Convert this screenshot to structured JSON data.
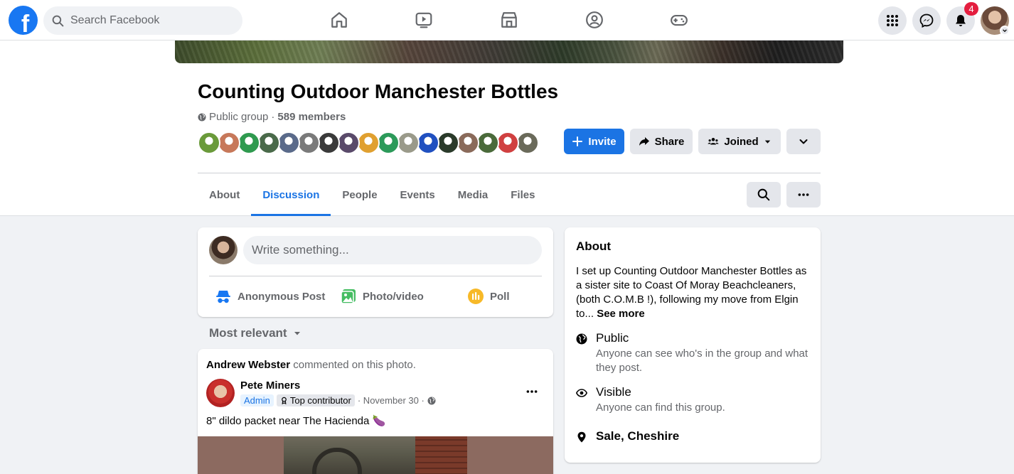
{
  "nav": {
    "logo": "f",
    "search_placeholder": "Search Facebook",
    "notification_count": "4"
  },
  "group": {
    "title": "Counting Outdoor Manchester Bottles",
    "privacy": "Public group",
    "separator": "·",
    "members": "589 members",
    "member_avatar_colors": [
      "#6a9a3a",
      "#c7785a",
      "#2f9a4f",
      "#4a6a4a",
      "#5a6a8a",
      "#7a7a7a",
      "#3a3a3a",
      "#5a4a6a",
      "#e0a030",
      "#2c9a5a",
      "#9a9a8a",
      "#2050c0",
      "#2a3a2a",
      "#8a6a5a",
      "#4a6a3a",
      "#d04040",
      "#6a6a5a"
    ],
    "buttons": {
      "invite": "Invite",
      "share": "Share",
      "joined": "Joined"
    }
  },
  "tabs": [
    "About",
    "Discussion",
    "People",
    "Events",
    "Media",
    "Files"
  ],
  "active_tab": "Discussion",
  "composer": {
    "placeholder": "Write something...",
    "actions": {
      "anonymous": "Anonymous Post",
      "photo": "Photo/video",
      "poll": "Poll"
    }
  },
  "feed": {
    "sort_label": "Most relevant"
  },
  "post": {
    "activity_actor": "Andrew Webster",
    "activity_text": "commented on this photo.",
    "author": "Pete Miners",
    "admin_badge": "Admin",
    "contributor_badge": "Top contributor",
    "date": "· November 30 ·",
    "text": "8\" dildo packet near The Hacienda 🍆"
  },
  "about": {
    "title": "About",
    "description": "I set up Counting Outdoor Manchester Bottles as a sister site to Coast Of Moray Beachcleaners, (both C.O.M.B !), following my move from Elgin to...",
    "see_more": "See more",
    "public_title": "Public",
    "public_desc": "Anyone can see who's in the group and what they post.",
    "visible_title": "Visible",
    "visible_desc": "Anyone can find this group.",
    "location": "Sale, Cheshire"
  },
  "colors": {
    "brand": "#1877f2",
    "primary_button": "#1b74e4",
    "badge_red": "#e41e3f"
  }
}
